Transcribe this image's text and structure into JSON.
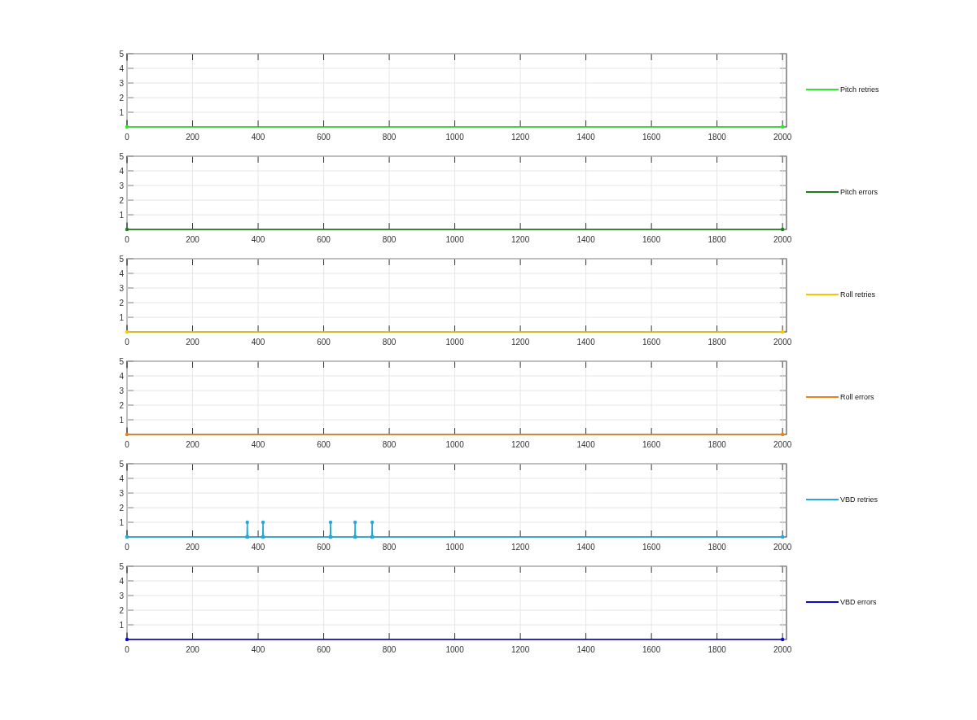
{
  "subplots": [
    {
      "chart_data": {
        "type": "line",
        "grid": true,
        "xlim": [
          0,
          2012
        ],
        "ylim": [
          0,
          5
        ],
        "xticks": [
          0,
          200,
          400,
          600,
          800,
          1000,
          1200,
          1400,
          1600,
          1800,
          2000
        ],
        "yticks": [
          1,
          2,
          3,
          4,
          5
        ],
        "x": [
          0,
          2000
        ],
        "series": [
          {
            "name": "Pitch retries",
            "color": "#2ee82e",
            "values": [
              0,
              0
            ]
          }
        ]
      }
    },
    {
      "chart_data": {
        "type": "line",
        "grid": true,
        "xlim": [
          0,
          2012
        ],
        "ylim": [
          0,
          5
        ],
        "xticks": [
          0,
          200,
          400,
          600,
          800,
          1000,
          1200,
          1400,
          1600,
          1800,
          2000
        ],
        "yticks": [
          1,
          2,
          3,
          4,
          5
        ],
        "x": [
          0,
          2000
        ],
        "series": [
          {
            "name": "Pitch errors",
            "color": "#1a7f1a",
            "values": [
              0,
              0
            ]
          }
        ]
      }
    },
    {
      "chart_data": {
        "type": "line",
        "grid": true,
        "xlim": [
          0,
          2012
        ],
        "ylim": [
          0,
          5
        ],
        "xticks": [
          0,
          200,
          400,
          600,
          800,
          1000,
          1200,
          1400,
          1600,
          1800,
          2000
        ],
        "yticks": [
          1,
          2,
          3,
          4,
          5
        ],
        "x": [
          0,
          2000
        ],
        "series": [
          {
            "name": "Roll retries",
            "color": "#f5c800",
            "values": [
              0,
              0
            ]
          }
        ]
      }
    },
    {
      "chart_data": {
        "type": "line",
        "grid": true,
        "xlim": [
          0,
          2012
        ],
        "ylim": [
          0,
          5
        ],
        "xticks": [
          0,
          200,
          400,
          600,
          800,
          1000,
          1200,
          1400,
          1600,
          1800,
          2000
        ],
        "yticks": [
          1,
          2,
          3,
          4,
          5
        ],
        "x": [
          0,
          2000
        ],
        "series": [
          {
            "name": "Roll errors",
            "color": "#e8821e",
            "values": [
              0,
              0
            ]
          }
        ]
      }
    },
    {
      "chart_data": {
        "type": "line",
        "grid": true,
        "xlim": [
          0,
          2012
        ],
        "ylim": [
          0,
          5
        ],
        "xticks": [
          0,
          200,
          400,
          600,
          800,
          1000,
          1200,
          1400,
          1600,
          1800,
          2000
        ],
        "yticks": [
          1,
          2,
          3,
          4,
          5
        ],
        "x": [
          0,
          366,
          367,
          368,
          414,
          415,
          416,
          620,
          621,
          622,
          695,
          696,
          697,
          747,
          748,
          749,
          2000
        ],
        "series": [
          {
            "name": "VBD retries",
            "color": "#22aadd",
            "values": [
              0,
              0,
              1,
              0,
              0,
              1,
              0,
              0,
              1,
              0,
              0,
              1,
              0,
              0,
              1,
              0,
              0
            ]
          }
        ]
      }
    },
    {
      "chart_data": {
        "type": "line",
        "grid": true,
        "xlim": [
          0,
          2012
        ],
        "ylim": [
          0,
          5
        ],
        "xticks": [
          0,
          200,
          400,
          600,
          800,
          1000,
          1200,
          1400,
          1600,
          1800,
          2000
        ],
        "yticks": [
          1,
          2,
          3,
          4,
          5
        ],
        "x": [
          0,
          2000
        ],
        "series": [
          {
            "name": "VBD errors",
            "color": "#0a0ac8",
            "values": [
              0,
              0
            ]
          }
        ]
      }
    }
  ]
}
